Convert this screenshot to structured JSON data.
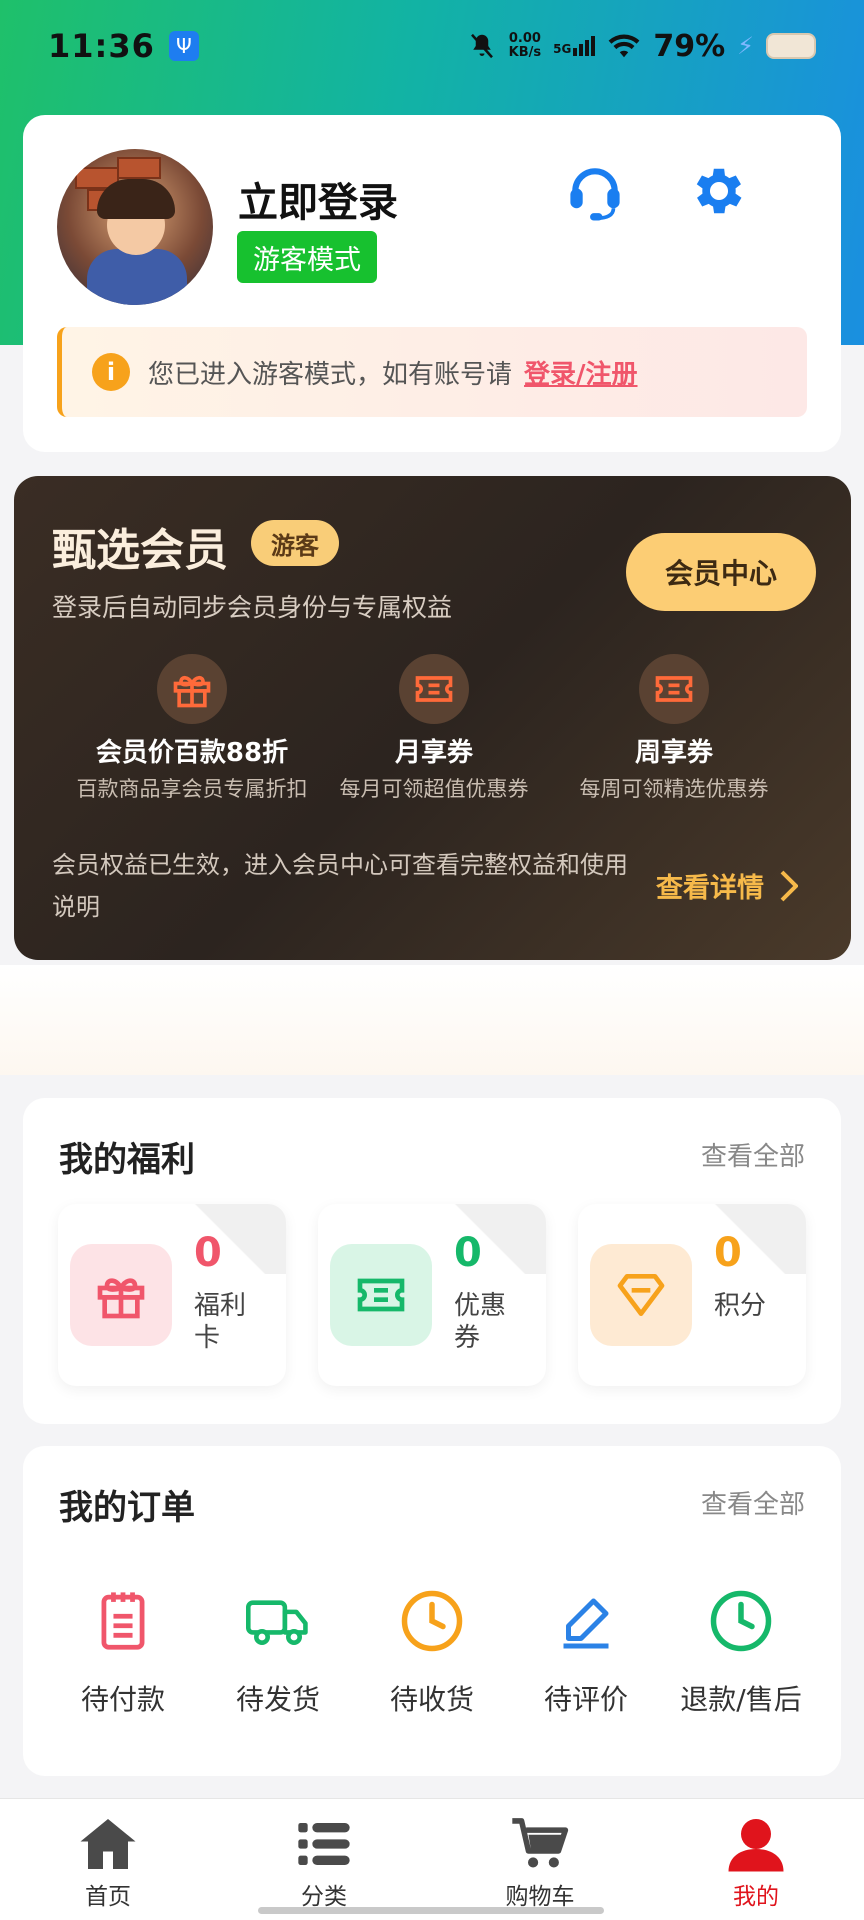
{
  "status_bar": {
    "time": "11:36",
    "net_speed_value": "0.00",
    "net_speed_unit": "KB/s",
    "network": "5G",
    "battery": "79%"
  },
  "profile": {
    "login_title": "立即登录",
    "guest_badge": "游客模式",
    "icons": [
      "headset-icon",
      "gear-icon"
    ],
    "notice_text": "您已进入游客模式，如有账号请",
    "notice_link": "登录/注册"
  },
  "member": {
    "title": "甄选会员",
    "tag": "游客",
    "subtitle": "登录后自动同步会员身份与专属权益",
    "center_button": "会员中心",
    "benefits": [
      {
        "icon": "gift-icon",
        "name": "会员价百款88折",
        "desc": "百款商品享会员专属折扣"
      },
      {
        "icon": "ticket-icon",
        "name": "月享券",
        "desc": "每月可领超值优惠券"
      },
      {
        "icon": "ticket-icon",
        "name": "周享券",
        "desc": "每周可领精选优惠券"
      }
    ],
    "footer_text": "会员权益已生效，进入会员中心可查看完整权益和使用说明",
    "detail_link": "查看详情"
  },
  "welfare": {
    "title": "我的福利",
    "more": "查看全部",
    "items": [
      {
        "icon": "gift-icon",
        "count": "0",
        "label": "福利卡",
        "color": "#f0566b"
      },
      {
        "icon": "ticket-icon",
        "count": "0",
        "label": "优惠券",
        "color": "#16b86a"
      },
      {
        "icon": "diamond-icon",
        "count": "0",
        "label": "积分",
        "color": "#f7a21b"
      }
    ]
  },
  "orders": {
    "title": "我的订单",
    "more": "查看全部",
    "items": [
      {
        "icon": "clipboard-icon",
        "label": "待付款",
        "color": "#f0566b"
      },
      {
        "icon": "truck-icon",
        "label": "待发货",
        "color": "#16b86a"
      },
      {
        "icon": "clock-icon",
        "label": "待收货",
        "color": "#f7a21b"
      },
      {
        "icon": "pen-icon",
        "label": "待评价",
        "color": "#2b82e6"
      },
      {
        "icon": "clock-icon",
        "label": "退款/售后",
        "color": "#16b86a"
      }
    ]
  },
  "nav": {
    "items": [
      {
        "icon": "home-icon",
        "label": "首页"
      },
      {
        "icon": "list-icon",
        "label": "分类"
      },
      {
        "icon": "cart-icon",
        "label": "购物车"
      },
      {
        "icon": "user-icon",
        "label": "我的"
      }
    ],
    "active_color": "#e0141c"
  }
}
